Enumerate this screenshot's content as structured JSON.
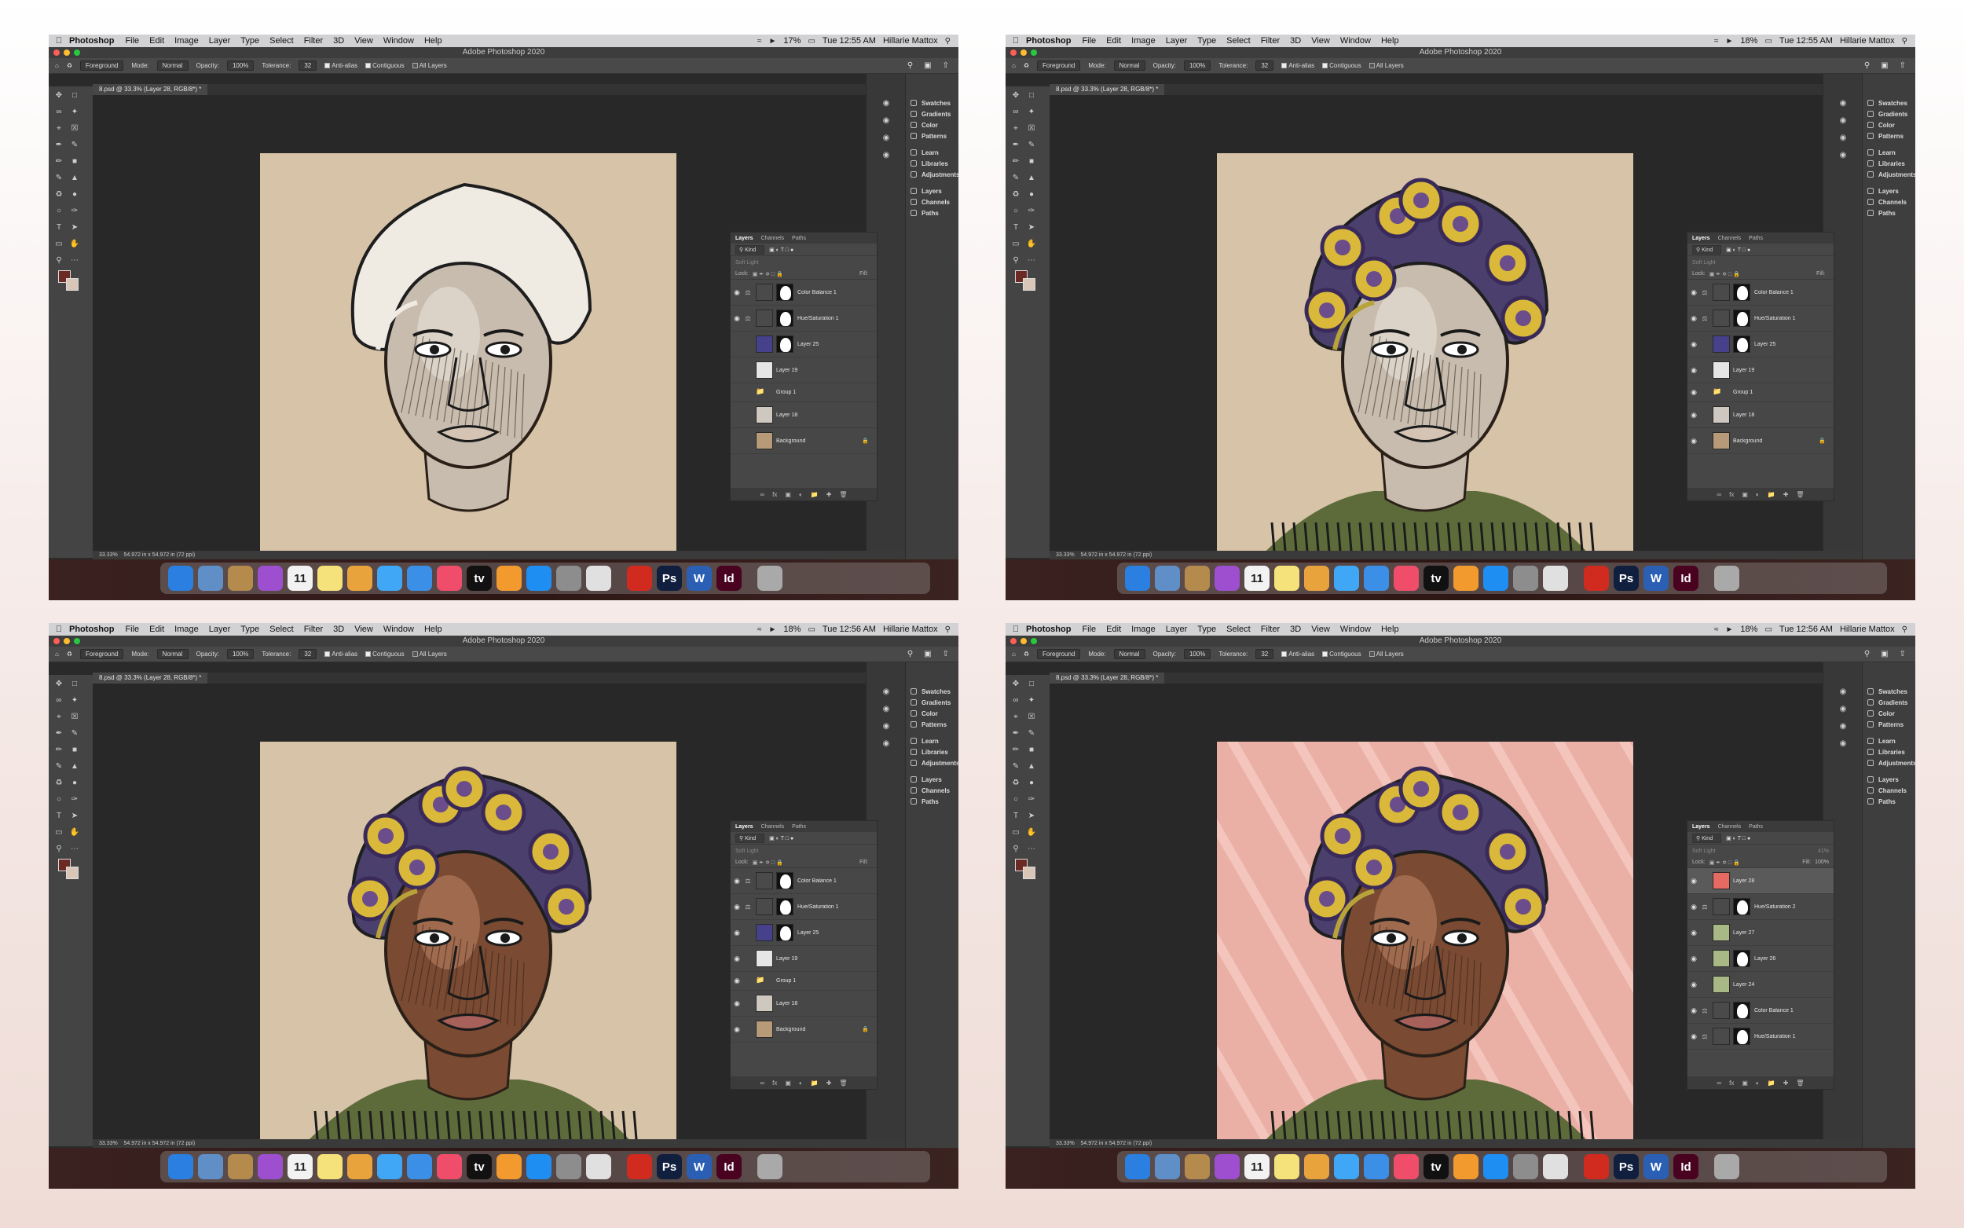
{
  "menubar": {
    "app": "Photoshop",
    "items": [
      "File",
      "Edit",
      "Image",
      "Layer",
      "Type",
      "Select",
      "Filter",
      "3D",
      "View",
      "Window",
      "Help"
    ],
    "user": "Hillarie Mattox"
  },
  "window_title": "Adobe Photoshop 2020",
  "options": {
    "preset": "Foreground",
    "mode_label": "Mode:",
    "mode_value": "Normal",
    "opacity_label": "Opacity:",
    "opacity_value": "100%",
    "tolerance_label": "Tolerance:",
    "tolerance_value": "32",
    "anti_alias": "Anti-alias",
    "contiguous": "Contiguous",
    "all_layers": "All Layers"
  },
  "doc_tab": "8.psd @ 33.3% (Layer 28, RGB/8*) *",
  "status": {
    "zoom": "33.33%",
    "size": "54.972 in x 54.972 in (72 ppi)"
  },
  "dock_panels": [
    "Swatches",
    "Gradients",
    "Color",
    "Patterns",
    "Learn",
    "Libraries",
    "Adjustments",
    "Layers",
    "Channels",
    "Paths"
  ],
  "layers_panel": {
    "tabs": [
      "Layers",
      "Channels",
      "Paths"
    ],
    "kind": "Kind",
    "lock_label": "Lock:",
    "fill_label": "Fill:"
  },
  "screens": [
    {
      "battery": "17%",
      "clock": "Tue 12:55 AM",
      "blend": "Soft Light",
      "layer_opacity": "",
      "fill": "",
      "layers": [
        "Color Balance 1",
        "Hue/Saturation 1",
        "Layer 25",
        "Layer 19",
        "Group 1",
        "Layer 18",
        "Background"
      ]
    },
    {
      "battery": "18%",
      "clock": "Tue 12:55 AM",
      "blend": "Soft Light",
      "layer_opacity": "",
      "fill": "",
      "layers": [
        "Color Balance 1",
        "Hue/Saturation 1",
        "Layer 25",
        "Layer 19",
        "Group 1",
        "Layer 18",
        "Background"
      ]
    },
    {
      "battery": "18%",
      "clock": "Tue 12:56 AM",
      "blend": "Soft Light",
      "layer_opacity": "",
      "fill": "",
      "layers": [
        "Color Balance 1",
        "Hue/Saturation 1",
        "Layer 25",
        "Layer 19",
        "Group 1",
        "Layer 18",
        "Background"
      ]
    },
    {
      "battery": "18%",
      "clock": "Tue 12:56 AM",
      "blend": "Soft Light",
      "layer_opacity": "41%",
      "fill": "100%",
      "layers": [
        "Layer 28",
        "Hue/Saturation 2",
        "Layer 27",
        "Layer 26",
        "Layer 24",
        "Color Balance 1",
        "Hue/Saturation 1"
      ]
    }
  ],
  "dock_apps": [
    {
      "icon": "finder-icon",
      "color": "#2a7fe0",
      "label": ""
    },
    {
      "icon": "preview-icon",
      "color": "#5f8fc6",
      "label": ""
    },
    {
      "icon": "notes-bag-icon",
      "color": "#b48a4d",
      "label": ""
    },
    {
      "icon": "podcasts-icon",
      "color": "#9d4fd0",
      "label": ""
    },
    {
      "icon": "calendar-icon",
      "color": "#f2f2f2",
      "label": "11"
    },
    {
      "icon": "stickies-icon",
      "color": "#f6e27a",
      "label": ""
    },
    {
      "icon": "photos-icon",
      "color": "#e8a33d",
      "label": ""
    },
    {
      "icon": "messages-icon",
      "color": "#3fa7f5",
      "label": ""
    },
    {
      "icon": "safari-icon",
      "color": "#3b8fe6",
      "label": ""
    },
    {
      "icon": "music-icon",
      "color": "#f04d6a",
      "label": ""
    },
    {
      "icon": "tv-icon",
      "color": "#111111",
      "label": "tv"
    },
    {
      "icon": "books-icon",
      "color": "#f29a2e",
      "label": ""
    },
    {
      "icon": "appstore-icon",
      "color": "#1e8ef2",
      "label": ""
    },
    {
      "icon": "settings-icon",
      "color": "#8d8d8d",
      "label": ""
    },
    {
      "icon": "chrome-icon",
      "color": "#e0e0e0",
      "label": ""
    },
    {
      "icon": "acrobat-icon",
      "color": "#d12a1f",
      "label": ""
    },
    {
      "icon": "photoshop-icon",
      "color": "#0f1f3d",
      "label": "Ps"
    },
    {
      "icon": "word-icon",
      "color": "#2b5fb4",
      "label": "W"
    },
    {
      "icon": "indesign-icon",
      "color": "#49021f",
      "label": "Id"
    },
    {
      "icon": "trash-icon",
      "color": "#a9a9a9",
      "label": ""
    }
  ]
}
